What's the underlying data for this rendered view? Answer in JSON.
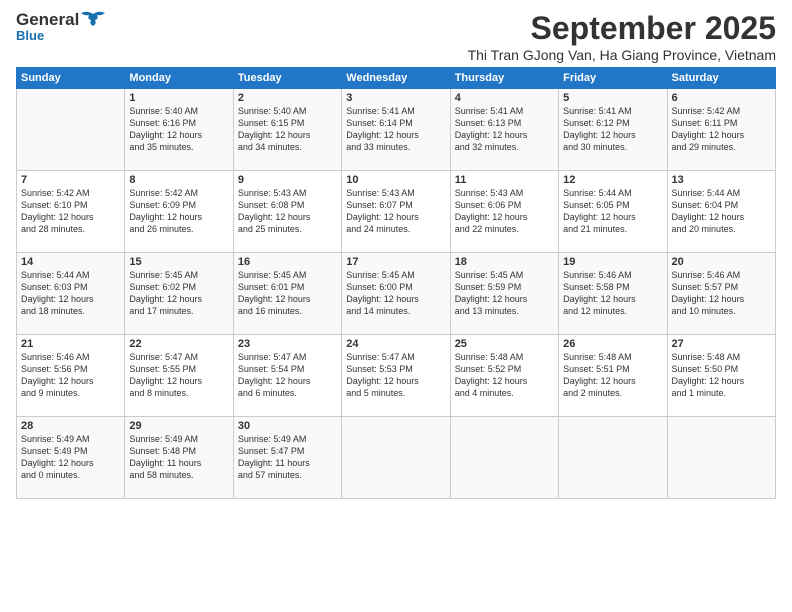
{
  "header": {
    "logo_general": "General",
    "logo_blue": "Blue",
    "month_title": "September 2025",
    "location": "Thi Tran GJong Van, Ha Giang Province, Vietnam"
  },
  "days_of_week": [
    "Sunday",
    "Monday",
    "Tuesday",
    "Wednesday",
    "Thursday",
    "Friday",
    "Saturday"
  ],
  "weeks": [
    [
      {
        "num": "",
        "lines": []
      },
      {
        "num": "1",
        "lines": [
          "Sunrise: 5:40 AM",
          "Sunset: 6:16 PM",
          "Daylight: 12 hours",
          "and 35 minutes."
        ]
      },
      {
        "num": "2",
        "lines": [
          "Sunrise: 5:40 AM",
          "Sunset: 6:15 PM",
          "Daylight: 12 hours",
          "and 34 minutes."
        ]
      },
      {
        "num": "3",
        "lines": [
          "Sunrise: 5:41 AM",
          "Sunset: 6:14 PM",
          "Daylight: 12 hours",
          "and 33 minutes."
        ]
      },
      {
        "num": "4",
        "lines": [
          "Sunrise: 5:41 AM",
          "Sunset: 6:13 PM",
          "Daylight: 12 hours",
          "and 32 minutes."
        ]
      },
      {
        "num": "5",
        "lines": [
          "Sunrise: 5:41 AM",
          "Sunset: 6:12 PM",
          "Daylight: 12 hours",
          "and 30 minutes."
        ]
      },
      {
        "num": "6",
        "lines": [
          "Sunrise: 5:42 AM",
          "Sunset: 6:11 PM",
          "Daylight: 12 hours",
          "and 29 minutes."
        ]
      }
    ],
    [
      {
        "num": "7",
        "lines": [
          "Sunrise: 5:42 AM",
          "Sunset: 6:10 PM",
          "Daylight: 12 hours",
          "and 28 minutes."
        ]
      },
      {
        "num": "8",
        "lines": [
          "Sunrise: 5:42 AM",
          "Sunset: 6:09 PM",
          "Daylight: 12 hours",
          "and 26 minutes."
        ]
      },
      {
        "num": "9",
        "lines": [
          "Sunrise: 5:43 AM",
          "Sunset: 6:08 PM",
          "Daylight: 12 hours",
          "and 25 minutes."
        ]
      },
      {
        "num": "10",
        "lines": [
          "Sunrise: 5:43 AM",
          "Sunset: 6:07 PM",
          "Daylight: 12 hours",
          "and 24 minutes."
        ]
      },
      {
        "num": "11",
        "lines": [
          "Sunrise: 5:43 AM",
          "Sunset: 6:06 PM",
          "Daylight: 12 hours",
          "and 22 minutes."
        ]
      },
      {
        "num": "12",
        "lines": [
          "Sunrise: 5:44 AM",
          "Sunset: 6:05 PM",
          "Daylight: 12 hours",
          "and 21 minutes."
        ]
      },
      {
        "num": "13",
        "lines": [
          "Sunrise: 5:44 AM",
          "Sunset: 6:04 PM",
          "Daylight: 12 hours",
          "and 20 minutes."
        ]
      }
    ],
    [
      {
        "num": "14",
        "lines": [
          "Sunrise: 5:44 AM",
          "Sunset: 6:03 PM",
          "Daylight: 12 hours",
          "and 18 minutes."
        ]
      },
      {
        "num": "15",
        "lines": [
          "Sunrise: 5:45 AM",
          "Sunset: 6:02 PM",
          "Daylight: 12 hours",
          "and 17 minutes."
        ]
      },
      {
        "num": "16",
        "lines": [
          "Sunrise: 5:45 AM",
          "Sunset: 6:01 PM",
          "Daylight: 12 hours",
          "and 16 minutes."
        ]
      },
      {
        "num": "17",
        "lines": [
          "Sunrise: 5:45 AM",
          "Sunset: 6:00 PM",
          "Daylight: 12 hours",
          "and 14 minutes."
        ]
      },
      {
        "num": "18",
        "lines": [
          "Sunrise: 5:45 AM",
          "Sunset: 5:59 PM",
          "Daylight: 12 hours",
          "and 13 minutes."
        ]
      },
      {
        "num": "19",
        "lines": [
          "Sunrise: 5:46 AM",
          "Sunset: 5:58 PM",
          "Daylight: 12 hours",
          "and 12 minutes."
        ]
      },
      {
        "num": "20",
        "lines": [
          "Sunrise: 5:46 AM",
          "Sunset: 5:57 PM",
          "Daylight: 12 hours",
          "and 10 minutes."
        ]
      }
    ],
    [
      {
        "num": "21",
        "lines": [
          "Sunrise: 5:46 AM",
          "Sunset: 5:56 PM",
          "Daylight: 12 hours",
          "and 9 minutes."
        ]
      },
      {
        "num": "22",
        "lines": [
          "Sunrise: 5:47 AM",
          "Sunset: 5:55 PM",
          "Daylight: 12 hours",
          "and 8 minutes."
        ]
      },
      {
        "num": "23",
        "lines": [
          "Sunrise: 5:47 AM",
          "Sunset: 5:54 PM",
          "Daylight: 12 hours",
          "and 6 minutes."
        ]
      },
      {
        "num": "24",
        "lines": [
          "Sunrise: 5:47 AM",
          "Sunset: 5:53 PM",
          "Daylight: 12 hours",
          "and 5 minutes."
        ]
      },
      {
        "num": "25",
        "lines": [
          "Sunrise: 5:48 AM",
          "Sunset: 5:52 PM",
          "Daylight: 12 hours",
          "and 4 minutes."
        ]
      },
      {
        "num": "26",
        "lines": [
          "Sunrise: 5:48 AM",
          "Sunset: 5:51 PM",
          "Daylight: 12 hours",
          "and 2 minutes."
        ]
      },
      {
        "num": "27",
        "lines": [
          "Sunrise: 5:48 AM",
          "Sunset: 5:50 PM",
          "Daylight: 12 hours",
          "and 1 minute."
        ]
      }
    ],
    [
      {
        "num": "28",
        "lines": [
          "Sunrise: 5:49 AM",
          "Sunset: 5:49 PM",
          "Daylight: 12 hours",
          "and 0 minutes."
        ]
      },
      {
        "num": "29",
        "lines": [
          "Sunrise: 5:49 AM",
          "Sunset: 5:48 PM",
          "Daylight: 11 hours",
          "and 58 minutes."
        ]
      },
      {
        "num": "30",
        "lines": [
          "Sunrise: 5:49 AM",
          "Sunset: 5:47 PM",
          "Daylight: 11 hours",
          "and 57 minutes."
        ]
      },
      {
        "num": "",
        "lines": []
      },
      {
        "num": "",
        "lines": []
      },
      {
        "num": "",
        "lines": []
      },
      {
        "num": "",
        "lines": []
      }
    ]
  ]
}
